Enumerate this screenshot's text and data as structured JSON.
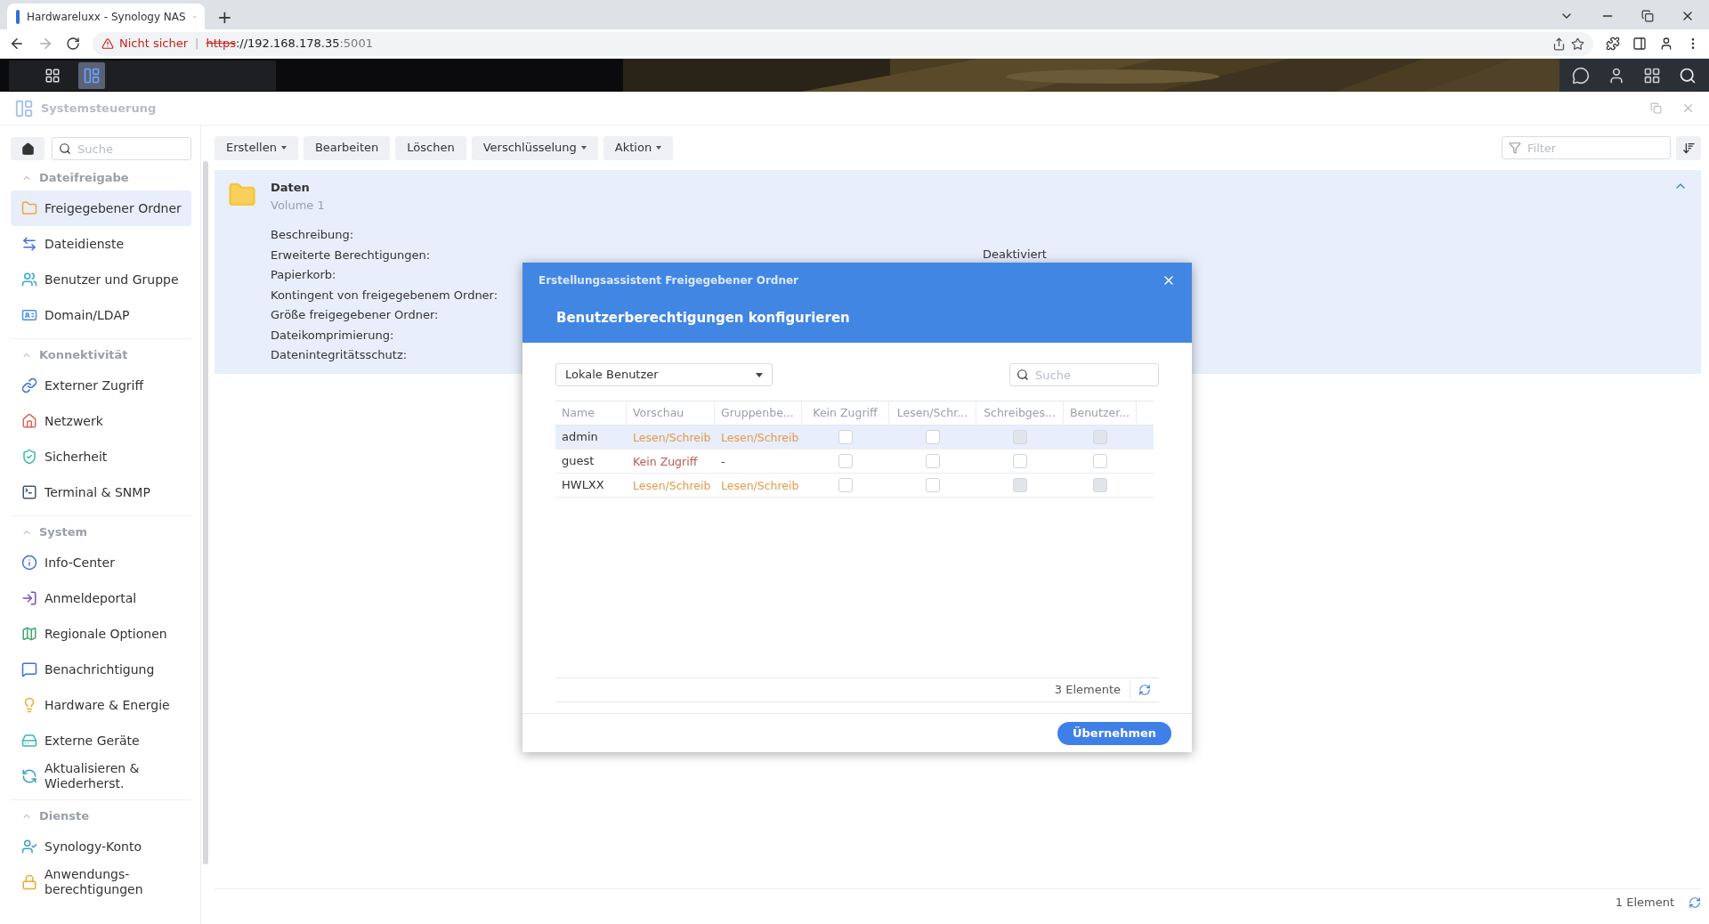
{
  "browser": {
    "tab_title": "Hardwareluxx - Synology NAS",
    "new_tab": "+",
    "security": "Nicht sicher",
    "separator": "|",
    "url_scheme": "https",
    "url_host": "://192.168.178.35",
    "url_port": ":5001"
  },
  "window": {
    "title": "Systemsteuerung"
  },
  "sidebar": {
    "search_placeholder": "Suche",
    "sections": [
      {
        "title": "Dateifreigabe",
        "expanded": true,
        "items": [
          {
            "label": "Freigegebener Ordner",
            "selected": true
          },
          {
            "label": "Dateidienste",
            "selected": false
          },
          {
            "label": "Benutzer und Gruppe",
            "selected": false
          },
          {
            "label": "Domain/LDAP",
            "selected": false
          }
        ]
      },
      {
        "title": "Konnektivität",
        "expanded": true,
        "items": [
          {
            "label": "Externer Zugriff",
            "selected": false
          },
          {
            "label": "Netzwerk",
            "selected": false
          },
          {
            "label": "Sicherheit",
            "selected": false
          },
          {
            "label": "Terminal & SNMP",
            "selected": false
          }
        ]
      },
      {
        "title": "System",
        "expanded": true,
        "items": [
          {
            "label": "Info-Center",
            "selected": false
          },
          {
            "label": "Anmeldeportal",
            "selected": false
          },
          {
            "label": "Regionale Optionen",
            "selected": false
          },
          {
            "label": "Benachrichtigung",
            "selected": false
          },
          {
            "label": "Hardware & Energie",
            "selected": false
          },
          {
            "label": "Externe Geräte",
            "selected": false
          },
          {
            "label": "Aktualisieren & Wiederherst.",
            "selected": false
          }
        ]
      },
      {
        "title": "Dienste",
        "expanded": true,
        "items": [
          {
            "label": "Synology-Konto",
            "selected": false
          },
          {
            "label": "Anwendungs-berechtigungen",
            "selected": false
          }
        ]
      }
    ]
  },
  "toolbar": {
    "buttons": [
      {
        "label": "Erstellen",
        "dropdown": true
      },
      {
        "label": "Bearbeiten",
        "dropdown": false
      },
      {
        "label": "Löschen",
        "dropdown": false
      },
      {
        "label": "Verschlüsselung",
        "dropdown": true
      },
      {
        "label": "Aktion",
        "dropdown": true
      }
    ],
    "filter_placeholder": "Filter"
  },
  "folder": {
    "name": "Daten",
    "volume": "Volume 1",
    "expanded": true,
    "properties": [
      {
        "label": "Beschreibung:"
      },
      {
        "label": "Erweiterte Berechtigungen:",
        "value": "Deaktiviert"
      },
      {
        "label": "Papierkorb:"
      },
      {
        "label": "Kontingent von freigegebenem Ordner:"
      },
      {
        "label": "Größe freigegebener Ordner:"
      },
      {
        "label": "Dateikomprimierung:"
      },
      {
        "label": "Datenintegritätsschutz:"
      }
    ]
  },
  "dialog": {
    "subtitle": "Erstellungsassistent Freigegebener Ordner",
    "title": "Benutzerberechtigungen konfigurieren",
    "source": "Lokale Benutzer",
    "search_placeholder": "Suche",
    "columns": [
      "Name",
      "Vorschau",
      "Gruppenbe...",
      "Kein Zugriff",
      "Lesen/Schr...",
      "Schreibges...",
      "Benutzer..."
    ],
    "rows": [
      {
        "name": "admin",
        "preview": {
          "text": "Lesen/Schreib",
          "color": "#e49a4a"
        },
        "group": {
          "text": "Lesen/Schreib",
          "color": "#e49a4a"
        },
        "selected": true,
        "perms": [
          {
            "checked": false,
            "disabled": false
          },
          {
            "checked": false,
            "disabled": false
          },
          {
            "checked": false,
            "disabled": true
          },
          {
            "checked": false,
            "disabled": true
          }
        ]
      },
      {
        "name": "guest",
        "preview": {
          "text": "Kein Zugriff",
          "color": "#c2574f"
        },
        "group": {
          "text": "-"
        },
        "selected": false,
        "perms": [
          {
            "checked": false,
            "disabled": false
          },
          {
            "checked": false,
            "disabled": false
          },
          {
            "checked": false,
            "disabled": false
          },
          {
            "checked": false,
            "disabled": false
          }
        ]
      },
      {
        "name": "HWLXX",
        "preview": {
          "text": "Lesen/Schreib",
          "color": "#e49a4a"
        },
        "group": {
          "text": "Lesen/Schreib",
          "color": "#e49a4a"
        },
        "selected": false,
        "perms": [
          {
            "checked": false,
            "disabled": false
          },
          {
            "checked": false,
            "disabled": false
          },
          {
            "checked": false,
            "disabled": true
          },
          {
            "checked": false,
            "disabled": true
          }
        ]
      }
    ],
    "count": "3 Elemente",
    "apply": "Übernehmen"
  },
  "status": {
    "count": "1 Element"
  }
}
